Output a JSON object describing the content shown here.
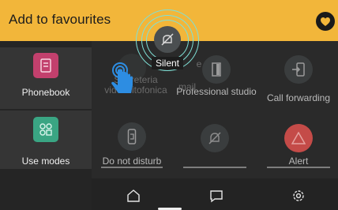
{
  "header": {
    "title": "Add to favourites",
    "favourite_icon": "heart-icon"
  },
  "sidebar": {
    "items": [
      {
        "label": "Phonebook",
        "icon": "phonebook-icon",
        "color": "#c2406d"
      },
      {
        "label": "Use modes",
        "icon": "use-modes-icon",
        "color": "#3aa583"
      }
    ]
  },
  "tiles": [
    {
      "label": "Videocitofonica",
      "icon": "video-intercom-icon"
    },
    {
      "label": "Professional studio",
      "icon": "door-icon"
    },
    {
      "label": "Call forwarding",
      "icon": "call-forwarding-icon"
    },
    {
      "label": "Do not disturb",
      "icon": "do-not-disturb-icon"
    },
    {
      "label": "",
      "icon": "silent-icon"
    },
    {
      "label": "Alert",
      "icon": "alert-icon",
      "color": "#c44b48"
    }
  ],
  "drag": {
    "label": "Silent",
    "icon": "silent-icon",
    "ghost_texts": [
      "Segreteria videocitofonica",
      "mail",
      "e"
    ]
  },
  "bottom_bar": {
    "items": [
      "home-icon",
      "message-icon",
      "settings-icon"
    ]
  },
  "pager": {
    "pages": 2,
    "current": 1
  },
  "colors": {
    "accent": "#f2b63a",
    "highlight_ring": "#7fe0d6"
  }
}
